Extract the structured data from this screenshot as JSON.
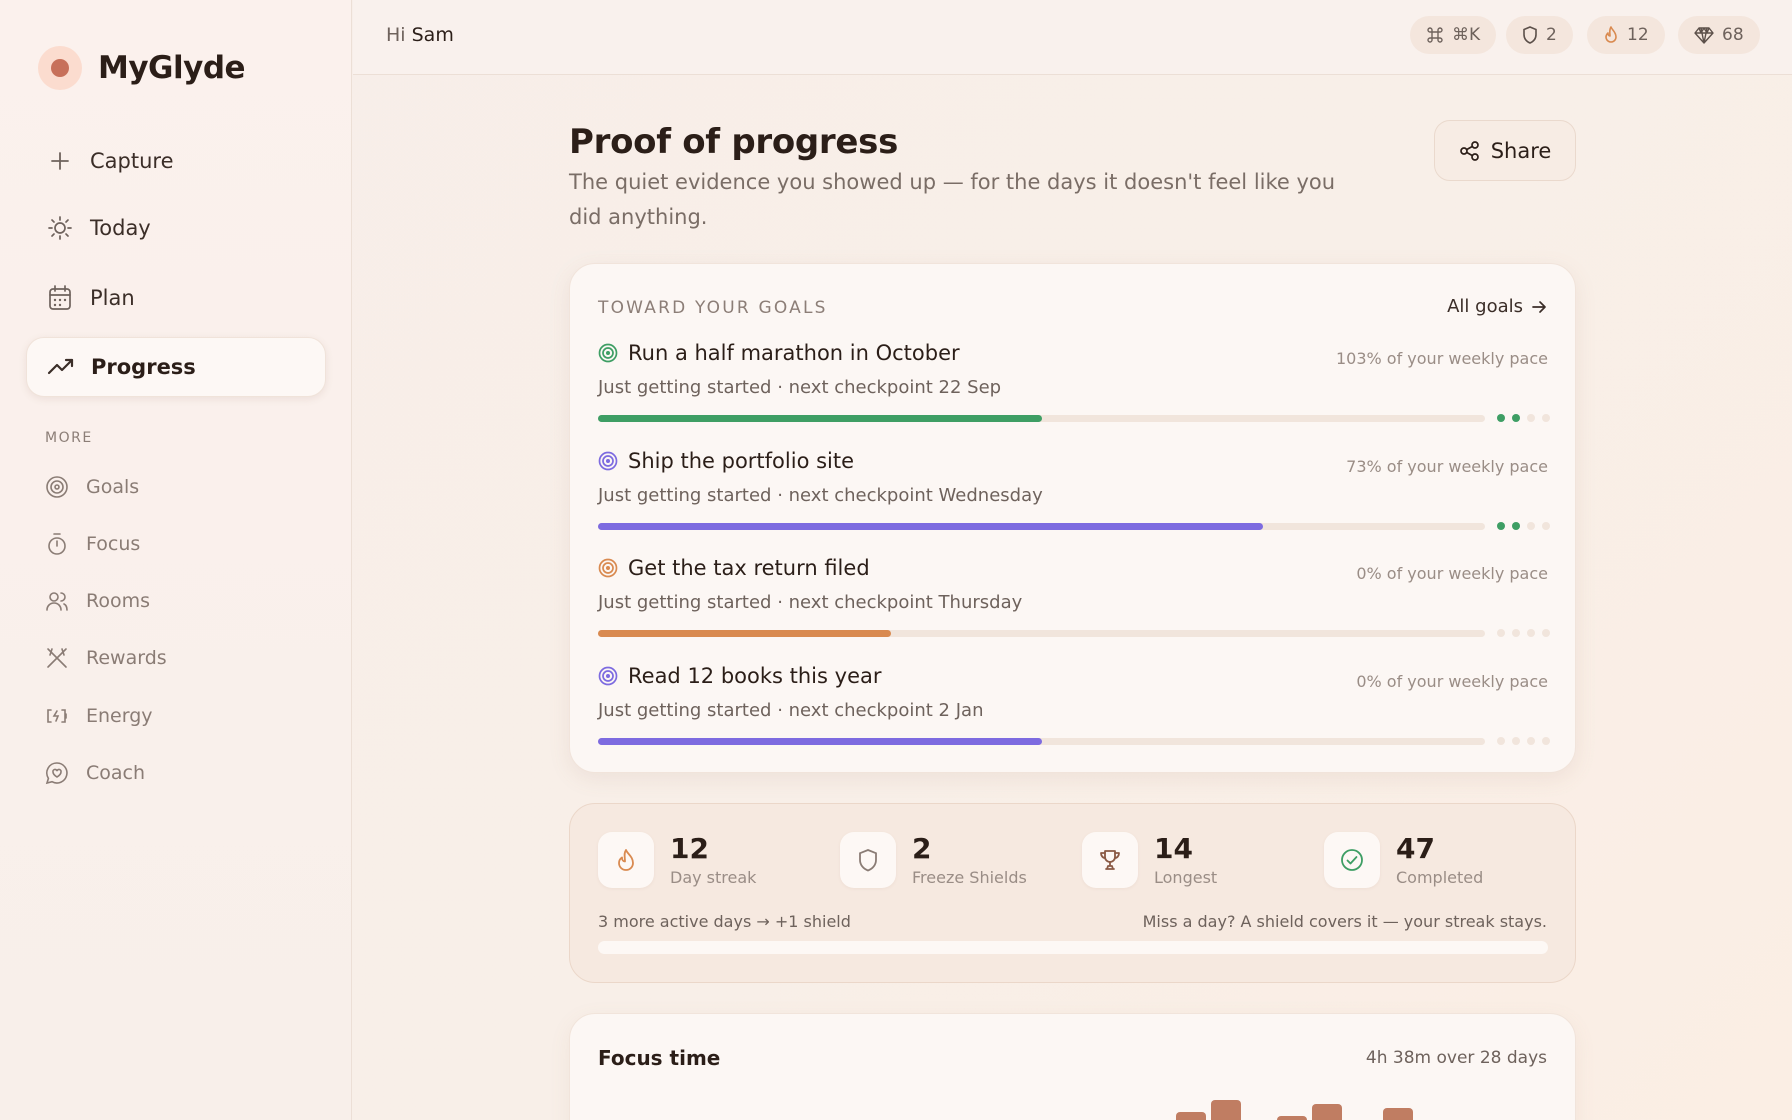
{
  "app": {
    "name": "MyGlyde"
  },
  "colors": {
    "accent": "#c7705a",
    "green": "#3e9e64",
    "purple": "#7d6be0",
    "orange": "#d98a50",
    "bar": "#c07d62"
  },
  "sidebar": {
    "primary": [
      {
        "label": "Capture",
        "icon": "plus-icon"
      },
      {
        "label": "Today",
        "icon": "sun-icon"
      },
      {
        "label": "Plan",
        "icon": "calendar-icon"
      },
      {
        "label": "Progress",
        "icon": "trending-up-icon",
        "active": true
      }
    ],
    "more_label": "MORE",
    "more": [
      {
        "label": "Goals",
        "icon": "target-icon"
      },
      {
        "label": "Focus",
        "icon": "stopwatch-icon"
      },
      {
        "label": "Rooms",
        "icon": "users-icon"
      },
      {
        "label": "Rewards",
        "icon": "gift-icon"
      },
      {
        "label": "Energy",
        "icon": "battery-icon"
      },
      {
        "label": "Coach",
        "icon": "chat-heart-icon"
      }
    ]
  },
  "topbar": {
    "greeting_prefix": "Hi",
    "user_name": "Sam",
    "shortcut": "⌘K",
    "shields": "2",
    "streak": "12",
    "gems": "68"
  },
  "page": {
    "title": "Proof of progress",
    "subtitle": "The quiet evidence you showed up — for the days it doesn't feel like you did anything.",
    "share_label": "Share"
  },
  "goals": {
    "section_label": "TOWARD YOUR GOALS",
    "all_goals_label": "All goals",
    "items": [
      {
        "title": "Run a half marathon in October",
        "sub": "Just getting started · next checkpoint 22 Sep",
        "pace": "103% of your weekly pace",
        "progress": 0.5,
        "color": "#3e9e64",
        "dots_on": 2
      },
      {
        "title": "Ship the portfolio site",
        "sub": "Just getting started · next checkpoint Wednesday",
        "pace": "73% of your weekly pace",
        "progress": 0.75,
        "color": "#7d6be0",
        "dots_on": 2
      },
      {
        "title": "Get the tax return filed",
        "sub": "Just getting started · next checkpoint Thursday",
        "pace": "0% of your weekly pace",
        "progress": 0.33,
        "color": "#d98a50",
        "dots_on": 0
      },
      {
        "title": "Read 12 books this year",
        "sub": "Just getting started · next checkpoint 2 Jan",
        "pace": "0% of your weekly pace",
        "progress": 0.5,
        "color": "#7d6be0",
        "dots_on": 0
      }
    ]
  },
  "streak": {
    "stats": [
      {
        "value": "12",
        "label": "Day streak",
        "icon": "flame-icon"
      },
      {
        "value": "2",
        "label": "Freeze Shields",
        "icon": "shield-icon"
      },
      {
        "value": "14",
        "label": "Longest",
        "icon": "trophy-icon"
      },
      {
        "value": "47",
        "label": "Completed",
        "icon": "check-circle-icon"
      }
    ],
    "left_note": "3 more active days → +1 shield",
    "right_note": "Miss a day? A shield covers it — your streak stays.",
    "shield_progress": 0.0
  },
  "focus": {
    "title": "Focus time",
    "summary": "4h 38m over 28 days"
  }
}
